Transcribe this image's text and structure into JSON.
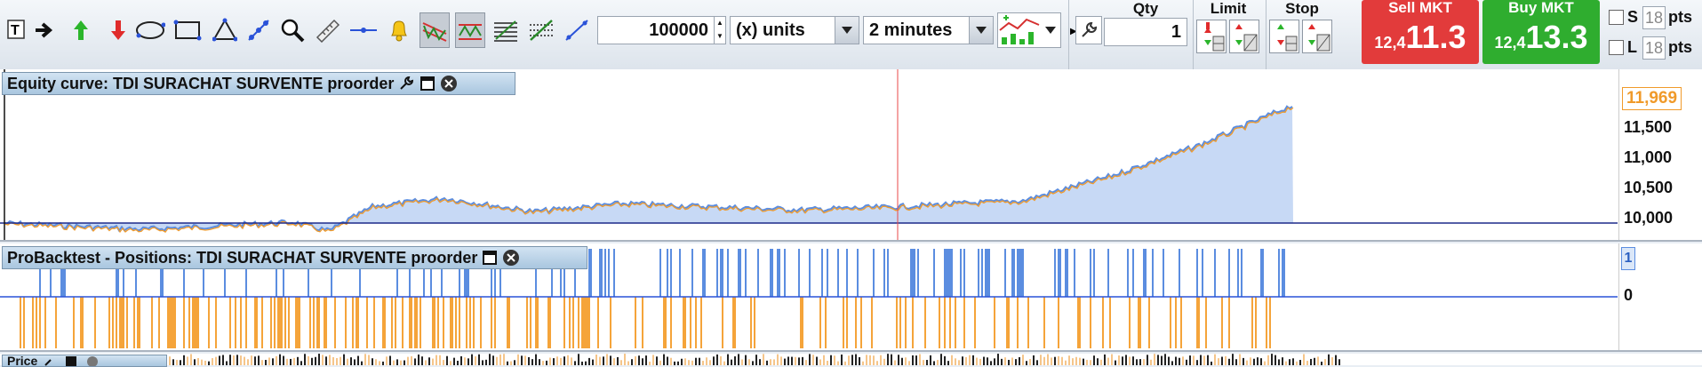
{
  "toolbar": {
    "tools": [
      "text-tool-icon",
      "arrow-right-icon",
      "buy-arrow-icon",
      "sell-arrow-icon",
      "ellipse-icon",
      "rectangle-icon",
      "triangle-icon",
      "line-points-icon",
      "zoom-icon",
      "ruler-icon",
      "horizontal-line-icon",
      "alert-bell-icon",
      "trend-down-icon",
      "trend-channel-icon",
      "fibonacci-icon",
      "regression-icon",
      "line-icon"
    ],
    "quantity_value": "100000",
    "units_label": "(x) units",
    "timeframe_label": "2 minutes",
    "strategy_icon": "backtest-chart-icon"
  },
  "order": {
    "qty_header": "Qty",
    "qty_value": "1",
    "limit_header": "Limit",
    "stop_header": "Stop",
    "sell": {
      "label": "Sell MKT",
      "small": "12,4",
      "big": "11.3",
      "color": "#e23b3b"
    },
    "buy": {
      "label": "Buy MKT",
      "small": "12,4",
      "big": "13.3",
      "color": "#2fad2f"
    },
    "s_label": "S",
    "s_value": "18",
    "s_unit": "pts",
    "l_label": "L",
    "l_value": "18",
    "l_unit": "pts"
  },
  "equity": {
    "title": "Equity curve: TDI SURACHAT SURVENTE proorder",
    "last_value": "11,969",
    "ticks": [
      "11,500",
      "11,000",
      "10,500",
      "10,000"
    ],
    "colors": {
      "line": "#5b8de0",
      "fill": "#c7d9f5",
      "orange": "#f09a2a",
      "baseline": "#1d2a8a"
    }
  },
  "positions": {
    "title": "ProBacktest - Positions: TDI SURACHAT SURVENTE proorder",
    "badge": "1",
    "zero_label": "0",
    "colors": {
      "long": "#5b8de0",
      "short": "#f5a43a"
    }
  },
  "price_panel": {
    "title": "Price"
  }
}
